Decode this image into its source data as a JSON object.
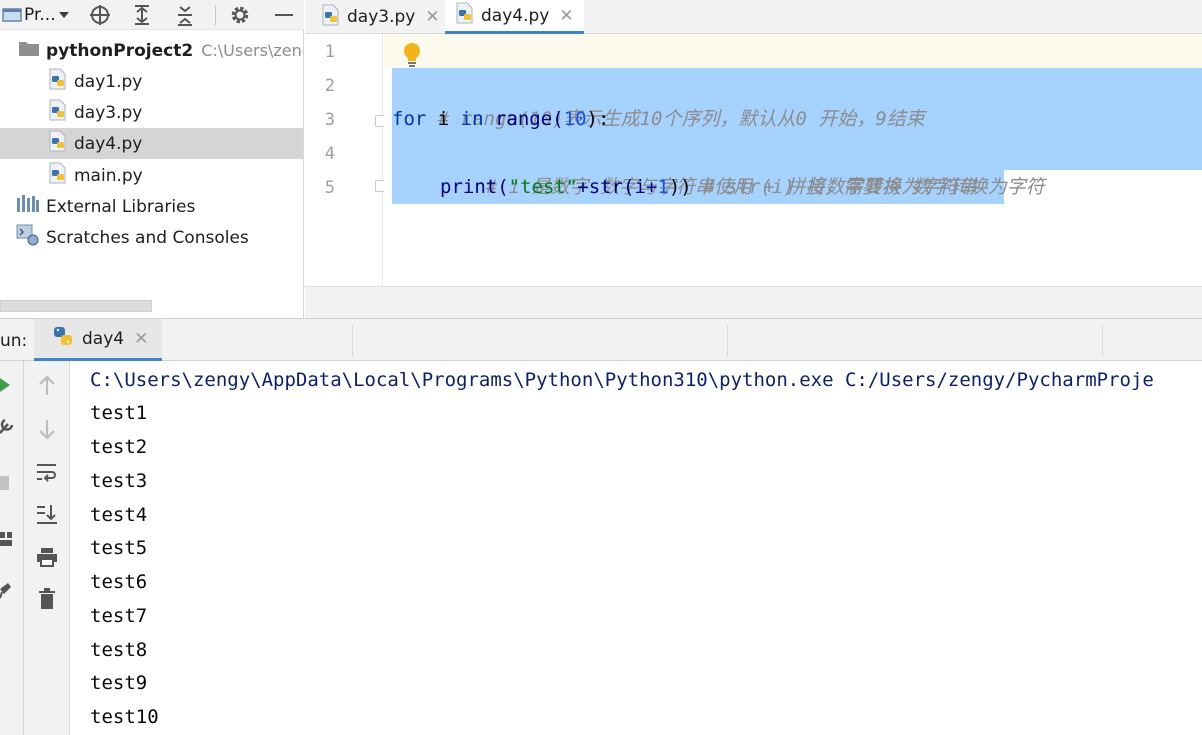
{
  "project_toolbar": {
    "title": "Pr...",
    "icons": [
      "project-window-icon",
      "chevron-down-icon",
      "locate-icon",
      "expand-all-icon",
      "collapse-all-icon",
      "gear-icon",
      "minimize-icon"
    ]
  },
  "project_tree": {
    "root": {
      "label": "pythonProject2",
      "path": "C:\\Users\\zengy"
    },
    "files": [
      {
        "label": "day1.py",
        "selected": false
      },
      {
        "label": "day3.py",
        "selected": false
      },
      {
        "label": "day4.py",
        "selected": true
      },
      {
        "label": "main.py",
        "selected": false
      }
    ],
    "external_libraries": "External Libraries",
    "scratches": "Scratches and Consoles"
  },
  "editor": {
    "tabs": [
      {
        "label": "day3.py",
        "active": false
      },
      {
        "label": "day4.py",
        "active": true
      }
    ],
    "line_numbers": [
      "1",
      "2",
      "3",
      "4",
      "5"
    ],
    "code": {
      "line2_comment": "# range(10)表示生成10个序列，默认从0 开始，9结束",
      "line3_for": "for",
      "line3_i": " i ",
      "line3_in": "in",
      "line3_range": " range(",
      "line3_num": "10",
      "line3_end": "):",
      "line4_comment": "# i 是数字 数字与字符串使用 + 拼接，需要将 数字转换为字符",
      "line5_print": "print(",
      "line5_str": "\"test\"",
      "line5_mid": "+str(i+",
      "line5_num": "1",
      "line5_end": ")) ",
      "line5_comment": "# str(i) 将数字转换为字符串"
    }
  },
  "run_panel": {
    "label": "un:",
    "tab": "day4",
    "console": {
      "command": "C:\\Users\\zengy\\AppData\\Local\\Programs\\Python\\Python310\\python.exe C:/Users/zengy/PycharmProje",
      "output": [
        "test1",
        "test2",
        "test3",
        "test4",
        "test5",
        "test6",
        "test7",
        "test8",
        "test9",
        "test10"
      ]
    }
  },
  "colors": {
    "selection": "#a6d2ff",
    "keyword": "#0033b3",
    "string": "#067d17",
    "number": "#1750eb",
    "comment": "#8c8c8c",
    "accent": "#4083c9"
  }
}
